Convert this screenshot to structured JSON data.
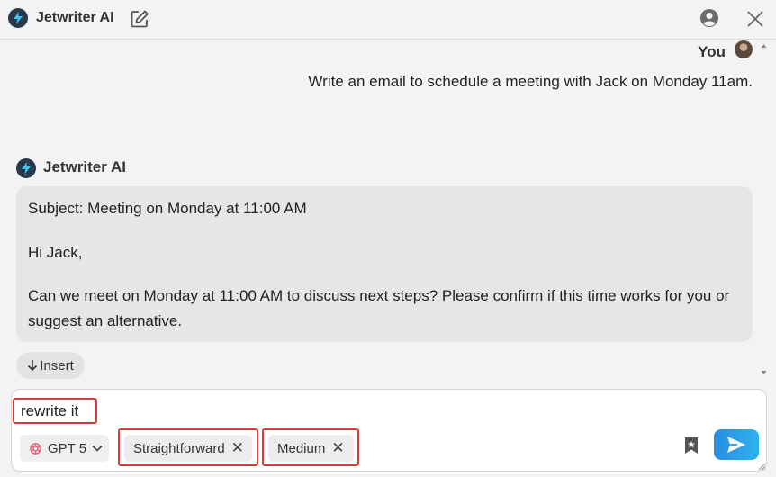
{
  "header": {
    "app_name": "Jetwriter AI"
  },
  "chat": {
    "user_name": "You",
    "user_message": "Write an email to schedule a meeting with Jack on Monday 11am.",
    "ai_name": "Jetwriter AI",
    "ai_paragraphs": [
      "Subject: Meeting on Monday at 11:00 AM",
      "Hi Jack,",
      "Can we meet on Monday at 11:00 AM to discuss next steps? Please confirm if this time works for you or suggest an alternative."
    ],
    "insert_label": "Insert"
  },
  "composer": {
    "input_value": "rewrite it",
    "model_label": "GPT 5",
    "chips": [
      "Straightforward",
      "Medium"
    ]
  },
  "colors": {
    "accent": "#2a9be6",
    "highlight": "#d43b3b",
    "logo_bg": "#28384d"
  }
}
